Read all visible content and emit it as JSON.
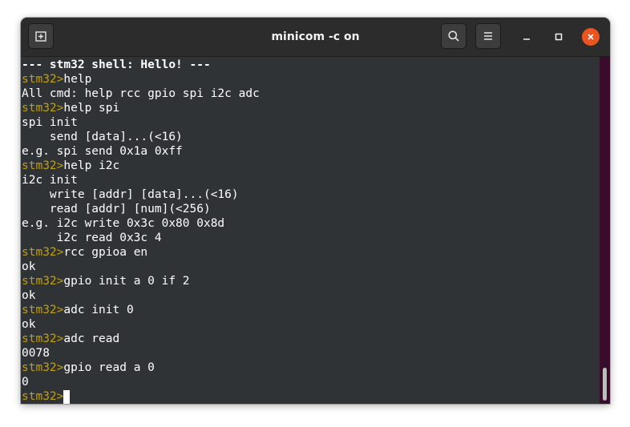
{
  "window": {
    "title": "minicom -c on",
    "icons": {
      "new_tab": "new-tab-icon",
      "search": "search-icon",
      "menu": "hamburger-menu-icon",
      "minimize": "minimize-icon",
      "maximize": "maximize-icon",
      "close": "close-icon"
    },
    "colors": {
      "prompt": "#c4a000",
      "text": "#ffffff",
      "background": "#2f3336",
      "close": "#e95420"
    }
  },
  "terminal": {
    "prompt": "stm32>",
    "lines": [
      {
        "prompt": "",
        "text": "--- stm32 shell: Hello! ---"
      },
      {
        "prompt": "stm32>",
        "text": "help"
      },
      {
        "prompt": "",
        "text": "All cmd: help rcc gpio spi i2c adc"
      },
      {
        "prompt": "stm32>",
        "text": "help spi"
      },
      {
        "prompt": "",
        "text": "spi init"
      },
      {
        "prompt": "",
        "text": "    send [data]...(<16)"
      },
      {
        "prompt": "",
        "text": "e.g. spi send 0x1a 0xff"
      },
      {
        "prompt": "stm32>",
        "text": "help i2c"
      },
      {
        "prompt": "",
        "text": "i2c init"
      },
      {
        "prompt": "",
        "text": "    write [addr] [data]...(<16)"
      },
      {
        "prompt": "",
        "text": "    read [addr] [num](<256)"
      },
      {
        "prompt": "",
        "text": "e.g. i2c write 0x3c 0x80 0x8d"
      },
      {
        "prompt": "",
        "text": "     i2c read 0x3c 4"
      },
      {
        "prompt": "stm32>",
        "text": "rcc gpioa en"
      },
      {
        "prompt": "",
        "text": "ok"
      },
      {
        "prompt": "stm32>",
        "text": "gpio init a 0 if 2"
      },
      {
        "prompt": "",
        "text": "ok"
      },
      {
        "prompt": "stm32>",
        "text": "adc init 0"
      },
      {
        "prompt": "",
        "text": "ok"
      },
      {
        "prompt": "stm32>",
        "text": "adc read"
      },
      {
        "prompt": "",
        "text": "0078"
      },
      {
        "prompt": "stm32>",
        "text": "gpio read a 0"
      },
      {
        "prompt": "",
        "text": "0"
      }
    ]
  }
}
